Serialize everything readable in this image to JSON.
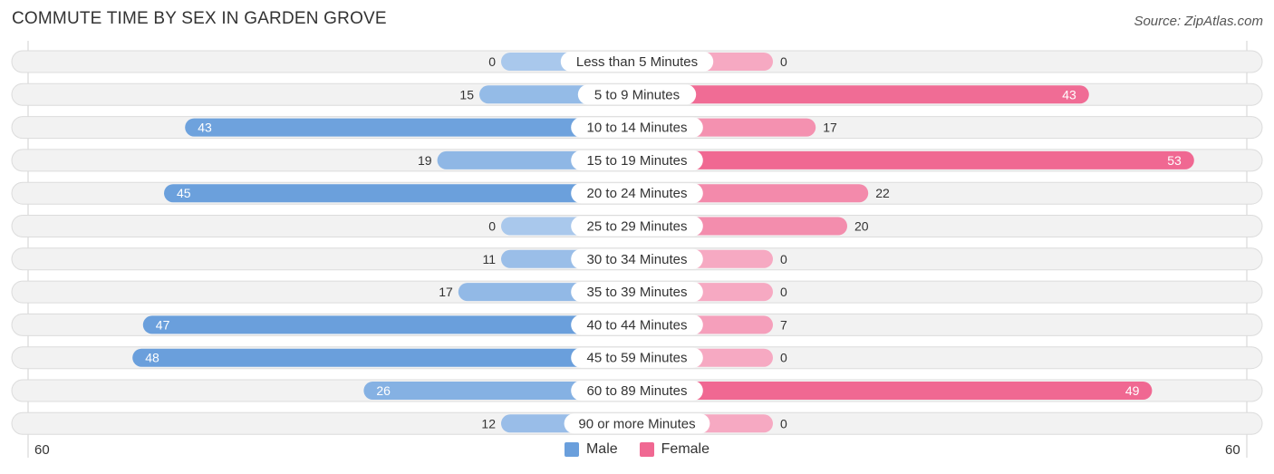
{
  "title": "COMMUTE TIME BY SEX IN GARDEN GROVE",
  "source": "Source: ZipAtlas.com",
  "colors": {
    "male": "#6a9fdc",
    "male_light": "#a9c8ec",
    "female": "#f06892",
    "female_light": "#f6a9c2",
    "track": "#f2f2f2"
  },
  "legend": [
    {
      "label": "Male",
      "color": "#6a9fdc"
    },
    {
      "label": "Female",
      "color": "#f06892"
    }
  ],
  "axis": {
    "left_label": "60",
    "right_label": "60"
  },
  "chart_data": {
    "type": "bar",
    "orientation": "horizontal-diverging",
    "title": "COMMUTE TIME BY SEX IN GARDEN GROVE",
    "categories": [
      "Less than 5 Minutes",
      "5 to 9 Minutes",
      "10 to 14 Minutes",
      "15 to 19 Minutes",
      "20 to 24 Minutes",
      "25 to 29 Minutes",
      "30 to 34 Minutes",
      "35 to 39 Minutes",
      "40 to 44 Minutes",
      "45 to 59 Minutes",
      "60 to 89 Minutes",
      "90 or more Minutes"
    ],
    "series": [
      {
        "name": "Male",
        "values": [
          0,
          15,
          43,
          19,
          45,
          0,
          11,
          17,
          47,
          48,
          26,
          12
        ]
      },
      {
        "name": "Female",
        "values": [
          0,
          43,
          17,
          53,
          22,
          20,
          0,
          0,
          7,
          0,
          49,
          0
        ]
      }
    ],
    "xlim": [
      -60,
      60
    ],
    "xlabel": "",
    "ylabel": "",
    "legend_position": "bottom-center",
    "grid": false
  }
}
